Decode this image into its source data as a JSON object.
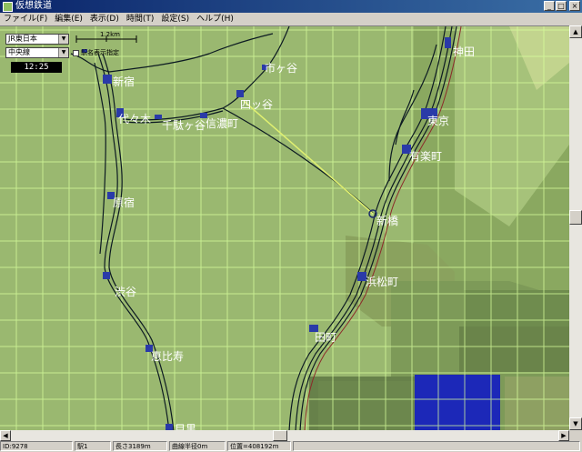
{
  "window": {
    "title": "仮想鉄道"
  },
  "menu": [
    "ファイル(F)",
    "編集(E)",
    "表示(D)",
    "時間(T)",
    "設定(S)",
    "ヘルプ(H)"
  ],
  "controls": {
    "company": "JR東日本",
    "line": "中央線",
    "clock": "12:25",
    "scale_label": "1.2km",
    "name_check_label": "駅名表示指定"
  },
  "stations": [
    "神田",
    "市ヶ谷",
    "新宿",
    "四ッ谷",
    "代々木",
    "千駄ヶ谷",
    "信濃町",
    "東京",
    "有楽町",
    "原宿",
    "新橋",
    "浜松町",
    "渋谷",
    "田町",
    "恵比寿",
    "目黒"
  ],
  "status": {
    "id": "ID:9278",
    "index": "駅1",
    "length": "長さ3189m",
    "radius": "曲線半径0m",
    "position": "位置=408192m"
  },
  "colors": {
    "map_bg": "#9ab870",
    "grid": "#d8ff9c",
    "rail": "#0c1a22",
    "station": "#2a3aa8",
    "water": "#1c28b8",
    "link": "#e0f070"
  },
  "icons": {
    "min": "minimize-icon",
    "max": "maximize-icon",
    "close": "close-icon"
  }
}
